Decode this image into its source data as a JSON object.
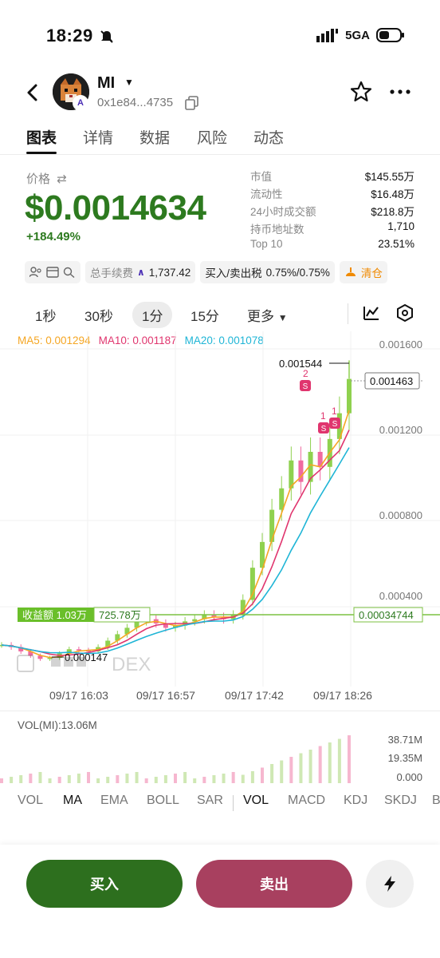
{
  "status_bar": {
    "time": "18:29",
    "network": "5GA"
  },
  "header": {
    "token_name": "MI",
    "address": "0x1e84...4735",
    "avatar_badge": "A"
  },
  "tabs": [
    "图表",
    "详情",
    "数据",
    "风险",
    "动态"
  ],
  "price": {
    "label": "价格",
    "value": "$0.0014634",
    "change": "+184.49%"
  },
  "stats": [
    {
      "k": "市值",
      "v": "$145.55万"
    },
    {
      "k": "流动性",
      "v": "$16.48万"
    },
    {
      "k": "24小时成交额",
      "v": "$218.8万"
    },
    {
      "k": "持币地址数",
      "v": "1,710"
    },
    {
      "k": "Top 10",
      "v": "23.51%"
    }
  ],
  "chips": {
    "fee_label": "总手续费",
    "fee_value": "1,737.42",
    "tax_label": "买入/卖出税",
    "tax_value": "0.75%/0.75%",
    "clear_label": "清仓"
  },
  "intervals": [
    "1秒",
    "30秒",
    "1分",
    "15分",
    "更多"
  ],
  "ma_legend": {
    "ma5": "MA5: 0.001294",
    "ma10": "MA10: 0.001187",
    "ma20": "MA20: 0.001078"
  },
  "chart": {
    "y_ticks": [
      "0.001600",
      "0.001200",
      "0.000800",
      "0.000400"
    ],
    "high_label": "0.001544",
    "low_label": "0.000147",
    "current_price_label": "0.001463",
    "cost_label": "0.00034744",
    "pnl_label": "收益额 1.03万",
    "pnl_amount": "725.78万",
    "watermark": "DEX",
    "markers": [
      "2",
      "1",
      "1"
    ],
    "marker_letter": "S"
  },
  "chart_data": {
    "type": "candlestick",
    "x_ticks": [
      "09/17 16:03",
      "09/17 16:57",
      "09/17 17:42",
      "09/17 18:26"
    ],
    "y_range": [
      0.0,
      0.0016
    ],
    "high": 0.001544,
    "low": 0.000147,
    "last": 0.001463,
    "close_series": [
      0.00022,
      0.00021,
      0.00019,
      0.00017,
      0.000155,
      0.00016,
      0.00018,
      0.0002,
      0.000195,
      0.00019,
      0.00021,
      0.00024,
      0.00027,
      0.0003,
      0.00033,
      0.00034,
      0.00032,
      0.0003,
      0.00031,
      0.00033,
      0.00034,
      0.00036,
      0.00035,
      0.00034,
      0.00036,
      0.00043,
      0.00058,
      0.0007,
      0.00085,
      0.00095,
      0.00108,
      0.00098,
      0.00112,
      0.00105,
      0.00118,
      0.0013,
      0.00146
    ],
    "ma_series": [
      {
        "name": "MA5",
        "color": "#f5a623",
        "last": 0.001294
      },
      {
        "name": "MA10",
        "color": "#e0356e",
        "last": 0.001187
      },
      {
        "name": "MA20",
        "color": "#1fb5d6",
        "last": 0.001078
      }
    ]
  },
  "volume": {
    "label": "VOL(MI):13.06M",
    "ticks": [
      "38.71M",
      "19.35M",
      "0.000"
    ]
  },
  "indicator_tabs": [
    "VOL",
    "MA",
    "EMA",
    "BOLL",
    "SAR",
    "VOL",
    "MACD",
    "KDJ",
    "SKDJ",
    "B"
  ],
  "actions": {
    "buy": "买入",
    "sell": "卖出"
  },
  "colors": {
    "up": "#2d7a1f",
    "down": "#e0356e",
    "buy": "#2d6f1e",
    "sell": "#a8405f"
  }
}
